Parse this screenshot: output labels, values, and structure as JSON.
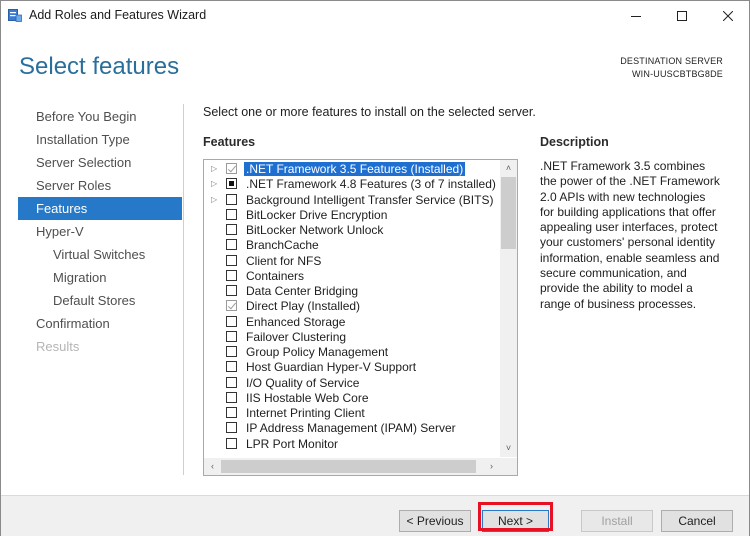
{
  "window": {
    "title": "Add Roles and Features Wizard",
    "controls": [
      "minimize-icon",
      "maximize-icon",
      "close-icon"
    ]
  },
  "page": {
    "heading": "Select features",
    "destination_label": "DESTINATION SERVER",
    "destination_server": "WIN-UUSCBTBG8DE",
    "instruction": "Select one or more features to install on the selected server.",
    "features_label": "Features",
    "description_label": "Description",
    "description_text": ".NET Framework 3.5 combines the power of the .NET Framework 2.0 APIs with new technologies for building applications that offer appealing user interfaces, protect your customers' personal identity information, enable seamless and secure communication, and provide the ability to model a range of business processes."
  },
  "nav": {
    "items": [
      {
        "label": "Before You Begin",
        "state": "normal"
      },
      {
        "label": "Installation Type",
        "state": "normal"
      },
      {
        "label": "Server Selection",
        "state": "normal"
      },
      {
        "label": "Server Roles",
        "state": "normal"
      },
      {
        "label": "Features",
        "state": "selected"
      },
      {
        "label": "Hyper-V",
        "state": "normal"
      },
      {
        "label": "Virtual Switches",
        "state": "sub"
      },
      {
        "label": "Migration",
        "state": "sub"
      },
      {
        "label": "Default Stores",
        "state": "sub"
      },
      {
        "label": "Confirmation",
        "state": "normal"
      },
      {
        "label": "Results",
        "state": "disabled"
      }
    ]
  },
  "features": [
    {
      "label": ".NET Framework 3.5 Features (Installed)",
      "expandable": true,
      "check": "checked-grey",
      "selected": true
    },
    {
      "label": ".NET Framework 4.8 Features (3 of 7 installed)",
      "expandable": true,
      "check": "partial",
      "selected": false
    },
    {
      "label": "Background Intelligent Transfer Service (BITS)",
      "expandable": true,
      "check": "unchecked",
      "selected": false
    },
    {
      "label": "BitLocker Drive Encryption",
      "expandable": false,
      "check": "unchecked",
      "selected": false
    },
    {
      "label": "BitLocker Network Unlock",
      "expandable": false,
      "check": "unchecked",
      "selected": false
    },
    {
      "label": "BranchCache",
      "expandable": false,
      "check": "unchecked",
      "selected": false
    },
    {
      "label": "Client for NFS",
      "expandable": false,
      "check": "unchecked",
      "selected": false
    },
    {
      "label": "Containers",
      "expandable": false,
      "check": "unchecked",
      "selected": false
    },
    {
      "label": "Data Center Bridging",
      "expandable": false,
      "check": "unchecked",
      "selected": false
    },
    {
      "label": "Direct Play (Installed)",
      "expandable": false,
      "check": "checked-grey",
      "selected": false
    },
    {
      "label": "Enhanced Storage",
      "expandable": false,
      "check": "unchecked",
      "selected": false
    },
    {
      "label": "Failover Clustering",
      "expandable": false,
      "check": "unchecked",
      "selected": false
    },
    {
      "label": "Group Policy Management",
      "expandable": false,
      "check": "unchecked",
      "selected": false
    },
    {
      "label": "Host Guardian Hyper-V Support",
      "expandable": false,
      "check": "unchecked",
      "selected": false
    },
    {
      "label": "I/O Quality of Service",
      "expandable": false,
      "check": "unchecked",
      "selected": false
    },
    {
      "label": "IIS Hostable Web Core",
      "expandable": false,
      "check": "unchecked",
      "selected": false
    },
    {
      "label": "Internet Printing Client",
      "expandable": false,
      "check": "unchecked",
      "selected": false
    },
    {
      "label": "IP Address Management (IPAM) Server",
      "expandable": false,
      "check": "unchecked",
      "selected": false
    },
    {
      "label": "LPR Port Monitor",
      "expandable": false,
      "check": "unchecked",
      "selected": false
    }
  ],
  "buttons": {
    "previous": "< Previous",
    "next": "Next >",
    "install": "Install",
    "cancel": "Cancel"
  },
  "colors": {
    "heading": "#2a6e9b",
    "nav_selected_bg": "#2679c9",
    "list_selection": "#1f6fd1",
    "highlight_box": "#e81123"
  }
}
